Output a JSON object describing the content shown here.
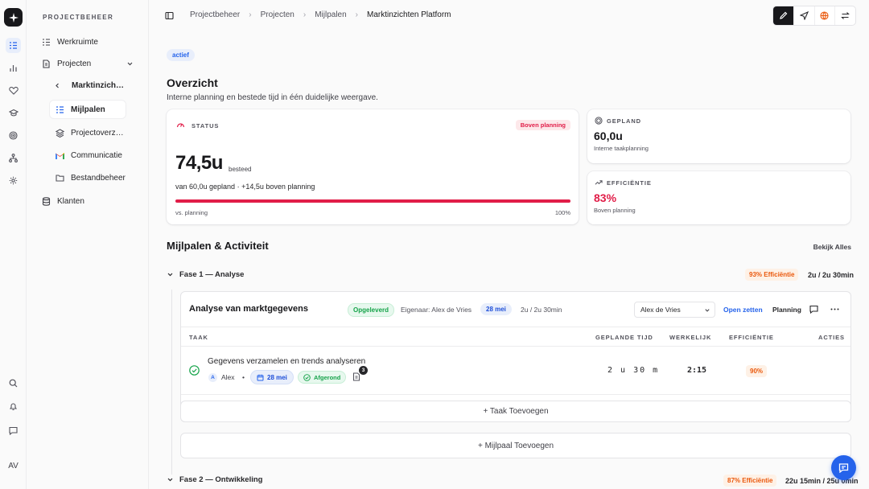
{
  "sidebar": {
    "section": "PROJECTBEHEER",
    "items": {
      "workspace": "Werkruimte",
      "projects": "Projecten",
      "current_project": "Marktinzich…",
      "milestones": "Mijlpalen",
      "overview": "Projectoverz…",
      "communication": "Communicatie",
      "files": "Bestandbeheer",
      "clients": "Klanten"
    },
    "user_initials": "AV"
  },
  "breadcrumb": [
    "Projectbeheer",
    "Projecten",
    "Mijlpalen",
    "Marktinzichten Platform"
  ],
  "status_chip": "actief",
  "page": {
    "title": "Overzicht",
    "subtitle": "Interne planning en bestede tijd in één duidelijke weergave."
  },
  "status_card": {
    "label": "STATUS",
    "badge": "Boven planning",
    "value": "74,5u",
    "value_suffix": "besteed",
    "detail": "van 60,0u gepland · +14,5u boven planning",
    "bar_label": "vs. planning",
    "bar_pct_label": "100%",
    "progress_fraction": 1.0
  },
  "planned_card": {
    "label": "GEPLAND",
    "value": "60,0u",
    "sub": "Interne taakplanning"
  },
  "efficiency_card": {
    "label": "EFFICIËNTIE",
    "value": "83%",
    "sub": "Boven planning"
  },
  "section": {
    "title": "Mijlpalen & Activiteit",
    "view_all": "Bekijk Alles"
  },
  "phase1": {
    "title": "Fase 1 — Analyse",
    "efficiency": "93% Efficiëntie",
    "time": "2u / 2u 30min"
  },
  "milestone": {
    "title": "Analyse van marktgegevens",
    "status": "Opgeleverd",
    "owner": "Eigenaar: Alex de Vries",
    "date": "28 mei",
    "time": "2u / 2u 30min",
    "assignee_select": "Alex de Vries",
    "open_label": "Open zetten",
    "planning_label": "Planning",
    "columns": {
      "task": "TAAK",
      "planned": "GEPLANDE TIJD",
      "actual": "WERKELIJK",
      "efficiency": "EFFICIËNTIE",
      "actions": "ACTIES"
    },
    "task": {
      "name": "Gegevens verzamelen en trends analyseren",
      "assignee_initial": "A",
      "assignee": "Alex",
      "date": "28 mei",
      "status": "Afgerond",
      "doc_count": "3",
      "planned": "2 u 30 m",
      "actual": "2:15",
      "efficiency": "90%"
    },
    "add_task": "+ Taak Toevoegen"
  },
  "add_milestone": "+ Mijlpaal Toevoegen",
  "phase2": {
    "title": "Fase 2 — Ontwikkeling",
    "efficiency": "87% Efficiëntie",
    "time": "22u 15min / 25u 0min"
  },
  "colors": {
    "accent": "#2563eb",
    "danger": "#e11d48",
    "success": "#16a34a",
    "warning": "#ea580c"
  }
}
